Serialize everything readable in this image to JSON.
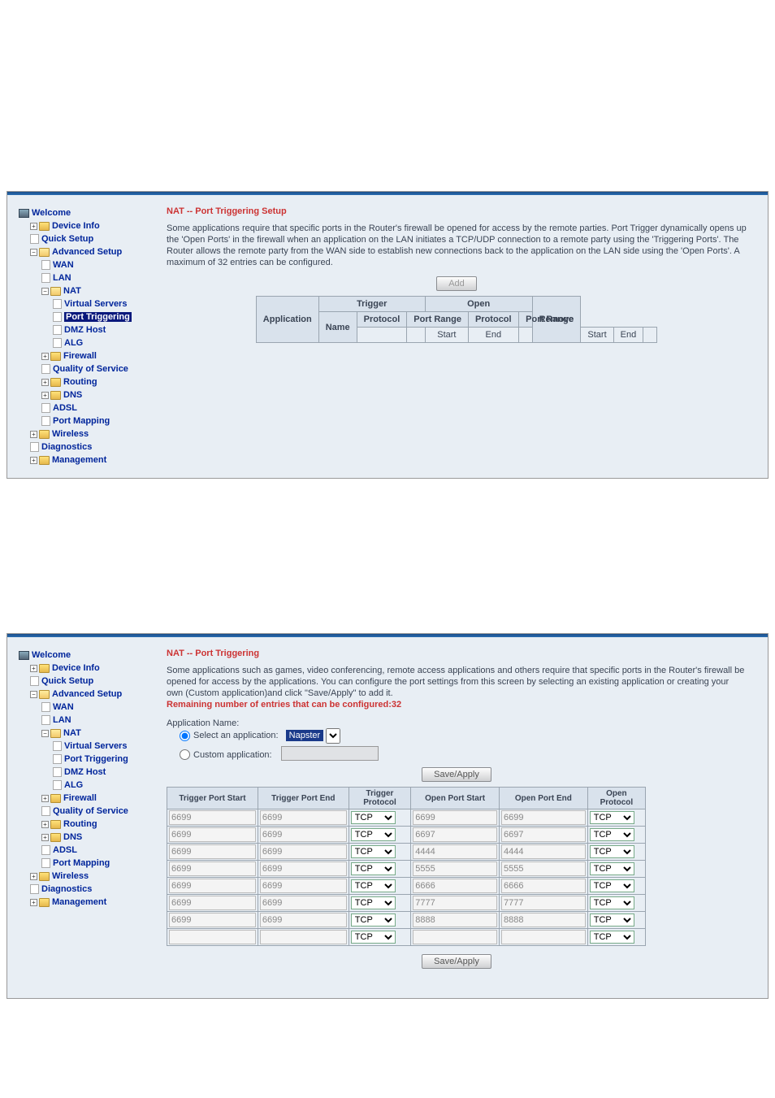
{
  "nav": {
    "welcome": "Welcome",
    "deviceInfo": "Device Info",
    "quickSetup": "Quick Setup",
    "advancedSetup": "Advanced Setup",
    "wan": "WAN",
    "lan": "LAN",
    "nat": "NAT",
    "virtualServers": "Virtual Servers",
    "portTriggering": "Port Triggering",
    "dmzHost": "DMZ Host",
    "alg": "ALG",
    "firewall": "Firewall",
    "qos": "Quality of Service",
    "routing": "Routing",
    "dns": "DNS",
    "adsl": "ADSL",
    "portMapping": "Port Mapping",
    "wireless": "Wireless",
    "diagnostics": "Diagnostics",
    "management": "Management"
  },
  "panel1": {
    "title": "NAT -- Port Triggering Setup",
    "desc": "Some applications require that specific ports in the Router's firewall be opened for access by the remote parties. Port Trigger dynamically opens up the 'Open Ports' in the firewall when an application on the LAN initiates a TCP/UDP connection to a remote party using the 'Triggering Ports'. The Router allows the remote party from the WAN side to establish new connections back to the application on the LAN side using the 'Open Ports'. A maximum of 32 entries can be configured.",
    "addBtn": "Add",
    "table": {
      "application": "Application",
      "trigger": "Trigger",
      "open": "Open",
      "remove": "Remove",
      "name": "Name",
      "protocol": "Protocol",
      "portRange": "Port Range",
      "start": "Start",
      "end": "End"
    }
  },
  "panel2": {
    "title": "NAT -- Port Triggering",
    "desc": "Some applications such as games, video conferencing, remote access applications and others require that specific ports in the Router's firewall be opened for access by the applications. You can configure the port settings from this screen by selecting an existing application or creating your own (Custom application)and click \"Save/Apply\" to add it.",
    "remainingLabel": "Remaining number of entries that can be configured:32",
    "appNameLabel": "Application Name:",
    "selectAppLabel": "Select an application:",
    "selectedApp": "Napster",
    "customAppLabel": "Custom application:",
    "saveApply": "Save/Apply",
    "headers": {
      "tps": "Trigger Port Start",
      "tpe": "Trigger Port End",
      "tproto": "Trigger Protocol",
      "ops": "Open Port Start",
      "ope": "Open Port End",
      "oproto": "Open Protocol"
    },
    "protoOption": "TCP",
    "chart_data": {
      "type": "table",
      "columns": [
        "Trigger Port Start",
        "Trigger Port End",
        "Trigger Protocol",
        "Open Port Start",
        "Open Port End",
        "Open Protocol"
      ],
      "rows": [
        {
          "tps": "6699",
          "tpe": "6699",
          "tproto": "TCP",
          "ops": "6699",
          "ope": "6699",
          "oproto": "TCP"
        },
        {
          "tps": "6699",
          "tpe": "6699",
          "tproto": "TCP",
          "ops": "6697",
          "ope": "6697",
          "oproto": "TCP"
        },
        {
          "tps": "6699",
          "tpe": "6699",
          "tproto": "TCP",
          "ops": "4444",
          "ope": "4444",
          "oproto": "TCP"
        },
        {
          "tps": "6699",
          "tpe": "6699",
          "tproto": "TCP",
          "ops": "5555",
          "ope": "5555",
          "oproto": "TCP"
        },
        {
          "tps": "6699",
          "tpe": "6699",
          "tproto": "TCP",
          "ops": "6666",
          "ope": "6666",
          "oproto": "TCP"
        },
        {
          "tps": "6699",
          "tpe": "6699",
          "tproto": "TCP",
          "ops": "7777",
          "ope": "7777",
          "oproto": "TCP"
        },
        {
          "tps": "6699",
          "tpe": "6699",
          "tproto": "TCP",
          "ops": "8888",
          "ope": "8888",
          "oproto": "TCP"
        },
        {
          "tps": "",
          "tpe": "",
          "tproto": "TCP",
          "ops": "",
          "ope": "",
          "oproto": "TCP"
        }
      ]
    }
  }
}
